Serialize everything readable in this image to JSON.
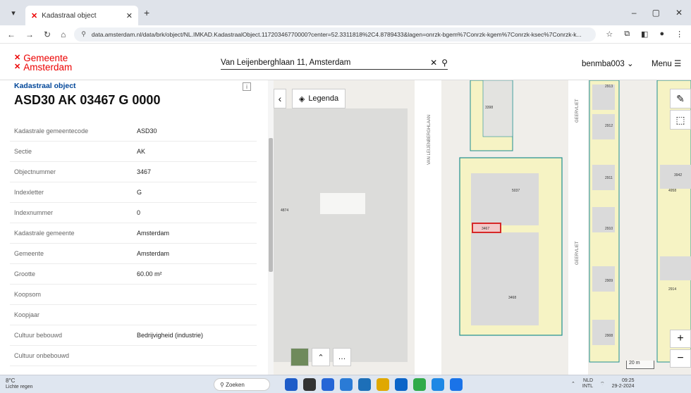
{
  "browser": {
    "tab_title": "Kadastraal object",
    "url": "data.amsterdam.nl/data/brk/object/NL.IMKAD.KadastraalObject.11720346770000?center=52.3311818%2C4.8789433&lagen=onrzk-bgem%7Conrzk-kgem%7Conrzk-ksec%7Conrzk-k..."
  },
  "header": {
    "logo_line1": "Gemeente",
    "logo_line2": "Amsterdam",
    "search_value": "Van Leijenberghlaan 11, Amsterdam",
    "user": "benmba003",
    "menu_label": "Menu"
  },
  "panel": {
    "subtitle": "Kadastraal object",
    "title": "ASD30 AK 03467 G 0000",
    "rows": [
      {
        "k": "Kadastrale gemeentecode",
        "v": "ASD30"
      },
      {
        "k": "Sectie",
        "v": "AK"
      },
      {
        "k": "Objectnummer",
        "v": "3467"
      },
      {
        "k": "Indexletter",
        "v": "G"
      },
      {
        "k": "Indexnummer",
        "v": "0"
      },
      {
        "k": "Kadastrale gemeente",
        "v": "Amsterdam"
      },
      {
        "k": "Gemeente",
        "v": "Amsterdam"
      },
      {
        "k": "Grootte",
        "v": "60.00 m²"
      },
      {
        "k": "Koopsom",
        "v": ""
      },
      {
        "k": "Koopjaar",
        "v": ""
      },
      {
        "k": "Cultuur bebouwd",
        "v": "Bedrijvigheid (industrie)"
      },
      {
        "k": "Cultuur onbebouwd",
        "v": ""
      }
    ]
  },
  "map": {
    "legend_label": "Legenda",
    "street1": "VAN LEIJENBERGHLAAN",
    "street2": "GEERVLIET",
    "street3": "GEERVLIET",
    "parcels": [
      "3398",
      "5037",
      "3467",
      "3468",
      "4874",
      "2913",
      "2912",
      "2911",
      "2910",
      "2909",
      "2908",
      "4958",
      "2914",
      "3942"
    ],
    "scale_label": "20 m"
  },
  "taskbar": {
    "temp": "8°C",
    "weather": "Lichte regen",
    "search": "Zoeken",
    "lang": "NLD",
    "lang2": "INTL",
    "time": "09:25",
    "date": "29-2-2024"
  },
  "colors": {
    "brand": "#ec0000",
    "link": "#004699",
    "parcel": "#1f8f8f",
    "selected": "#d62828",
    "parcel_fill": "#f6f3c4"
  }
}
